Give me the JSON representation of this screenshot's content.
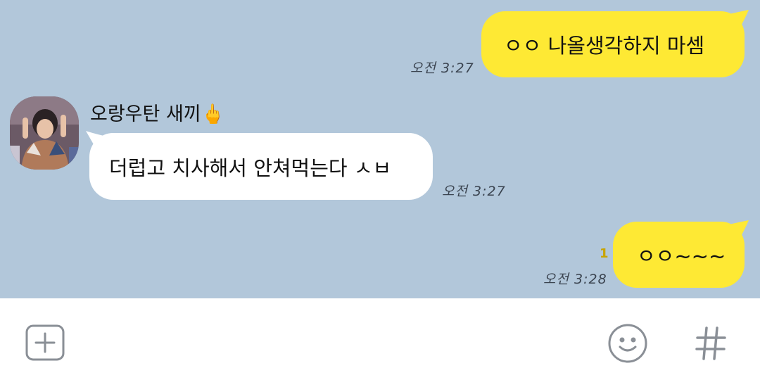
{
  "messages": [
    {
      "side": "mine",
      "text": "ㅇㅇ 나올생각하지 마셈",
      "time": "오전 3:27"
    },
    {
      "side": "theirs",
      "sender": "오랑우탄 새끼🖕",
      "text": "더럽고 치사해서 안쳐먹는다 ㅅㅂ",
      "time": "오전 3:27"
    },
    {
      "side": "mine",
      "text": "ㅇㅇ~~~",
      "time": "오전 3:28",
      "unread": "1"
    }
  ],
  "input_bar": {
    "attach_icon": "plus-square-icon",
    "emoji_icon": "smiley-icon",
    "hash_icon": "hash-icon"
  },
  "colors": {
    "chat_background": "#b2c7da",
    "my_bubble": "#fee934",
    "their_bubble": "#ffffff",
    "icon_gray": "#8a8f96"
  }
}
